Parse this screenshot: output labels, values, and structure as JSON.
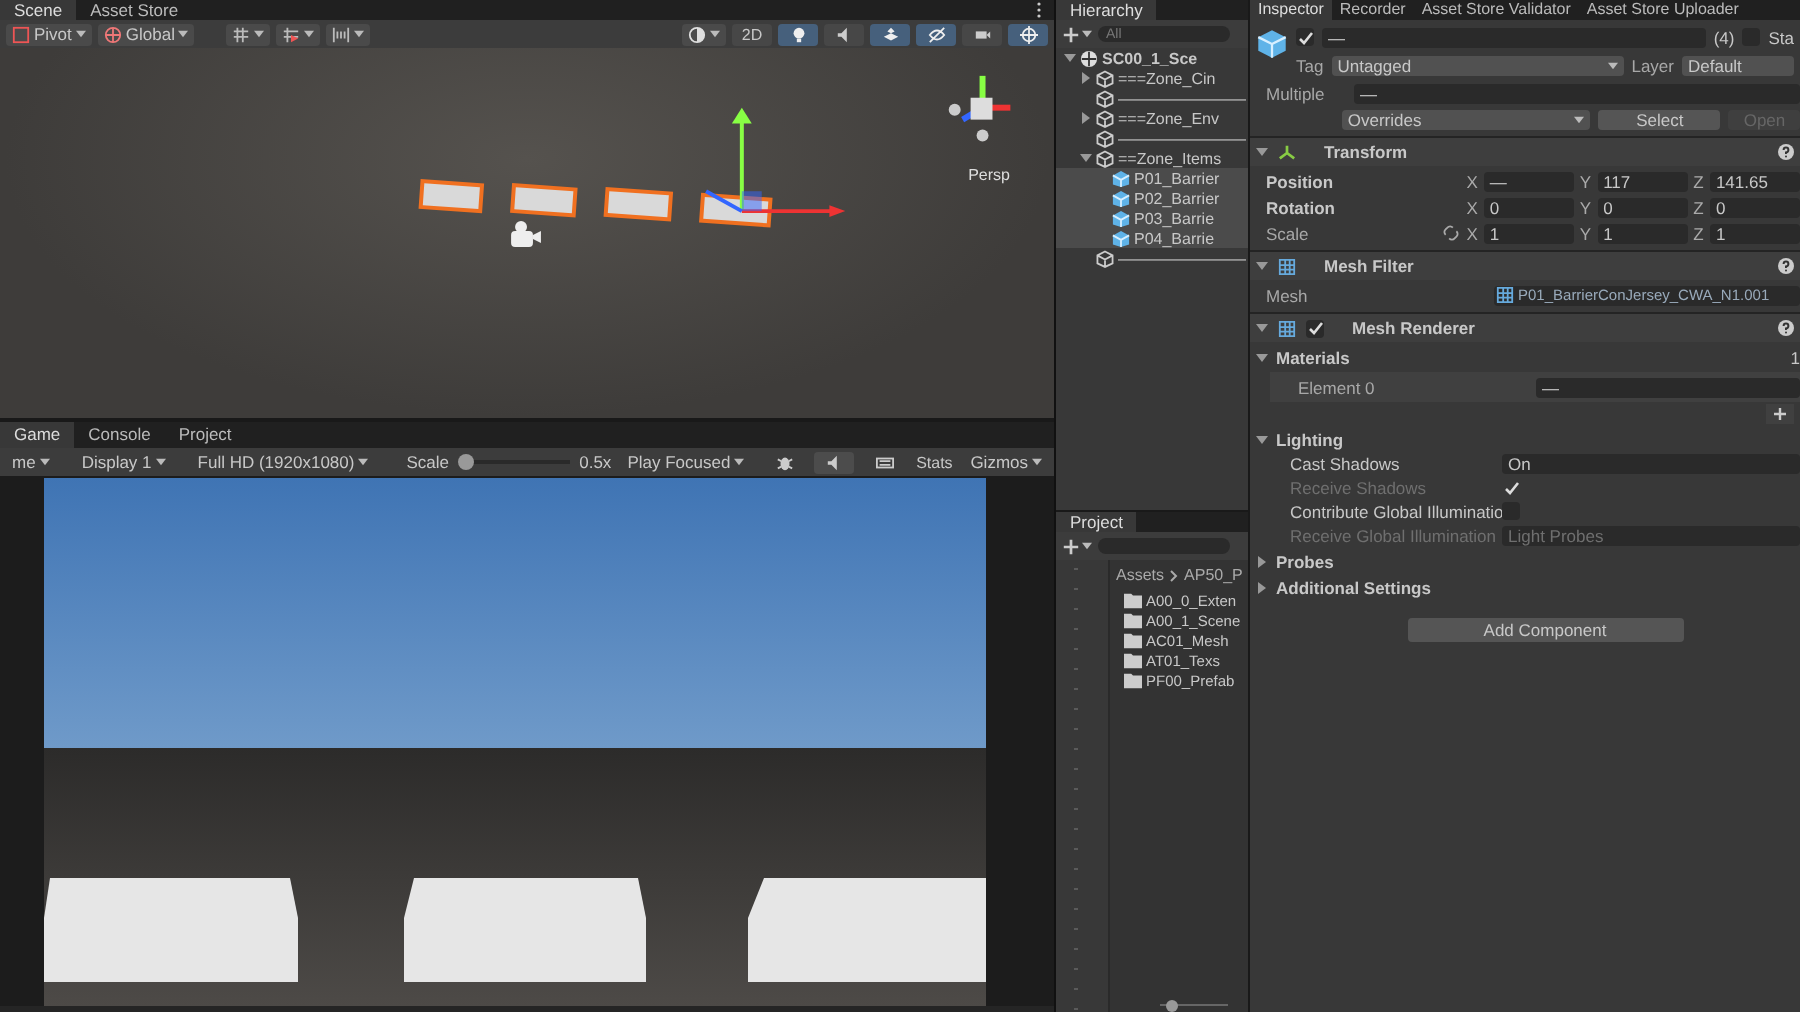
{
  "scene_panel": {
    "tabs": [
      {
        "label": "Scene",
        "selected": true
      },
      {
        "label": "Asset Store",
        "selected": false
      }
    ],
    "toolbar": {
      "pivot": "Pivot",
      "space": "Global",
      "two_d": {
        "label": "2D",
        "on": false
      },
      "toggles": [
        {
          "kind": "lighting",
          "on": true
        },
        {
          "kind": "audio",
          "on": false
        },
        {
          "kind": "effects",
          "on": true
        },
        {
          "kind": "visibility",
          "on": true
        },
        {
          "kind": "camera",
          "on": false
        },
        {
          "kind": "gizmos",
          "on": true
        }
      ]
    },
    "view": {
      "projection": "Persp"
    }
  },
  "game_panel": {
    "tabs": [
      {
        "label": "Game",
        "selected": true
      },
      {
        "label": "Console",
        "selected": false
      },
      {
        "label": "Project",
        "selected": false
      }
    ],
    "toolbar": {
      "mode": "me",
      "display": "Display 1",
      "resolution": "Full HD (1920x1080)",
      "scale_label": "Scale",
      "scale": {
        "level": 0
      },
      "scale_reading": "0.5x",
      "play_mode": "Play Focused",
      "toggles": [
        {
          "kind": "bug",
          "on": false
        },
        {
          "kind": "audio",
          "on": true
        },
        {
          "kind": "keyboard",
          "on": false
        }
      ],
      "stats": "Stats",
      "gizmos": "Gizmos"
    }
  },
  "hierarchy": {
    "title": "Hierarchy",
    "search_placeholder": "All",
    "items": [
      {
        "name": "SC00_1_Sce",
        "kind": "scene",
        "selected": false,
        "expanded": true,
        "children": [
          {
            "name": "===Zone_Cin",
            "kind": "gameobject",
            "selected": false,
            "expanded": false
          },
          {
            "name": "————————",
            "kind": "gameobject",
            "selected": false
          },
          {
            "name": "===Zone_Env",
            "kind": "gameobject",
            "selected": false,
            "expanded": false
          },
          {
            "name": "————————",
            "kind": "gameobject",
            "selected": false
          },
          {
            "name": "==Zone_Items",
            "kind": "gameobject",
            "selected": false,
            "expanded": true,
            "children": [
              {
                "name": "P01_Barrier",
                "kind": "prefab",
                "selected": true
              },
              {
                "name": "P02_Barrier",
                "kind": "prefab",
                "selected": true
              },
              {
                "name": "P03_Barrie",
                "kind": "prefab",
                "selected": true
              },
              {
                "name": "P04_Barrie",
                "kind": "prefab",
                "selected": true
              }
            ]
          },
          {
            "name": "————————",
            "kind": "gameobject",
            "selected": false
          }
        ]
      }
    ]
  },
  "project": {
    "title": "Project",
    "breadcrumb": [
      "Assets",
      "AP50_P"
    ],
    "folders": [
      "A00_0_Exten",
      "A00_1_Scene",
      "AC01_Mesh",
      "AT01_Texs",
      "PF00_Prefab"
    ],
    "zoom": {
      "level": 0.1
    }
  },
  "inspector": {
    "tabs": [
      {
        "label": "Inspector",
        "selected": true
      },
      {
        "label": "Recorder",
        "selected": false
      },
      {
        "label": "Asset Store Validator",
        "selected": false
      },
      {
        "label": "Asset Store Uploader",
        "selected": false
      }
    ],
    "object": {
      "active": true,
      "name": "—",
      "count": "(4)",
      "static_label": "Sta",
      "static": false,
      "tag_label": "Tag",
      "tag": "Untagged",
      "layer_label": "Layer",
      "layer": "Default",
      "multiple_label": "Multiple",
      "multiple": "—",
      "overrides": "Overrides",
      "select": "Select",
      "open": "Open"
    },
    "transform": {
      "title": "Transform",
      "expanded": true,
      "rows": [
        {
          "label": "Position",
          "fields": [
            {
              "axis": "X",
              "value": "—"
            },
            {
              "axis": "Y",
              "value": "117"
            },
            {
              "axis": "Z",
              "value": "141.65"
            }
          ]
        },
        {
          "label": "Rotation",
          "fields": [
            {
              "axis": "X",
              "value": "0"
            },
            {
              "axis": "Y",
              "value": "0"
            },
            {
              "axis": "Z",
              "value": "0"
            }
          ]
        },
        {
          "label": "Scale",
          "fields": [
            {
              "axis": "X",
              "value": "1"
            },
            {
              "axis": "Y",
              "value": "1"
            },
            {
              "axis": "Z",
              "value": "1"
            }
          ]
        }
      ]
    },
    "mesh_filter": {
      "title": "Mesh Filter",
      "expanded": true,
      "mesh_label": "Mesh",
      "mesh": "P01_BarrierConJersey_CWA_N1.001"
    },
    "mesh_renderer": {
      "title": "Mesh Renderer",
      "expanded": true,
      "enabled": true,
      "materials": {
        "label": "Materials",
        "expanded": true,
        "count": "1",
        "elements": [
          {
            "label": "Element 0",
            "value": "—"
          }
        ]
      },
      "lighting": {
        "label": "Lighting",
        "expanded": true,
        "rows": [
          {
            "kind": "dropdown",
            "label": "Cast Shadows",
            "value": "On",
            "disabled": false
          },
          {
            "kind": "checkbox",
            "label": "Receive Shadows",
            "checked": true,
            "disabled": true
          },
          {
            "kind": "checkbox",
            "label": "Contribute Global Illuminatio",
            "checked": false,
            "disabled": false
          },
          {
            "kind": "dropdown",
            "label": "Receive Global Illumination",
            "value": "Light Probes",
            "disabled": true
          }
        ]
      },
      "sections": [
        {
          "label": "Probes",
          "expanded": false
        },
        {
          "label": "Additional Settings",
          "expanded": false
        }
      ]
    },
    "add_component": "Add Component"
  }
}
